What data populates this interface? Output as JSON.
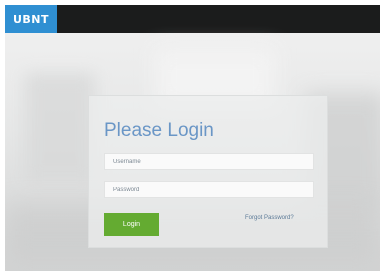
{
  "header": {
    "logo_text": "UBNT",
    "logo_color": "#2f8fd2"
  },
  "login": {
    "title": "Please Login",
    "username_placeholder": "Username",
    "password_placeholder": "Password",
    "login_button_label": "Login",
    "forgot_password_label": "Forgot Password?",
    "button_color": "#64ab31"
  }
}
